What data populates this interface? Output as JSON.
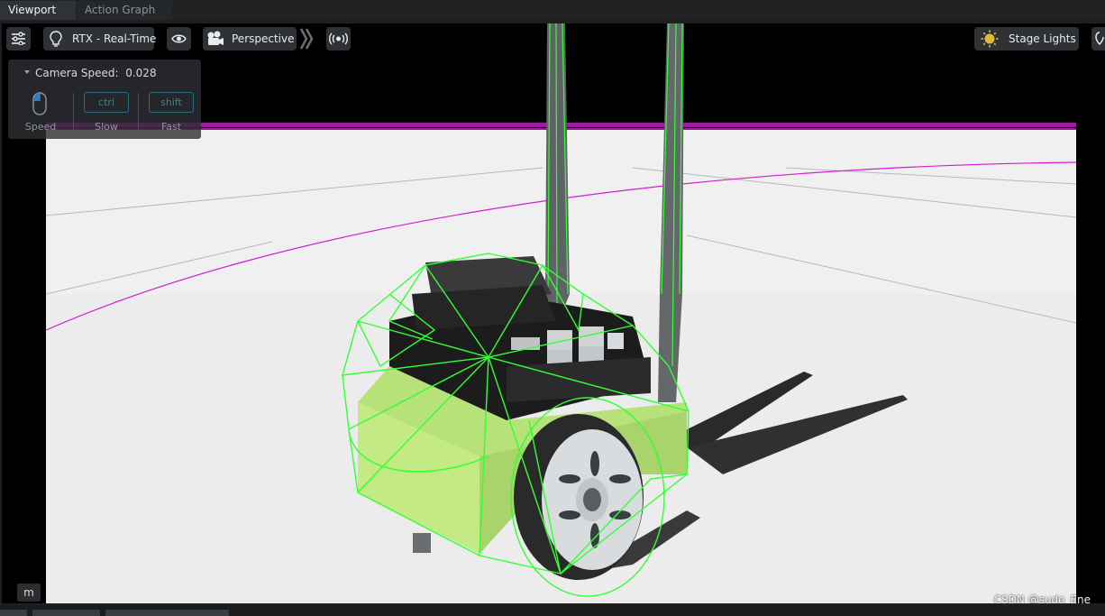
{
  "tabs": [
    {
      "label": "Viewport",
      "active": true
    },
    {
      "label": "Action Graph",
      "active": false
    }
  ],
  "toolbar": {
    "settings_icon": "sliders-icon",
    "render_mode": {
      "icon": "lightbulb-icon",
      "label": "RTX - Real-Time"
    },
    "visibility_icon": "eye-icon",
    "camera": {
      "icon": "camera-icon",
      "label": "Perspective"
    },
    "expand_icon": "double-chevron-right-icon",
    "audio_icon": "broadcast-icon",
    "lights": {
      "icon": "sun-icon",
      "label": "Stage Lights"
    }
  },
  "camera_speed": {
    "title": "Camera Speed:",
    "value": "0.028",
    "keys": [
      {
        "key": "",
        "label": "Speed",
        "icon": "mouse-icon"
      },
      {
        "key": "ctrl",
        "label": "Slow"
      },
      {
        "key": "shift",
        "label": "Fast"
      }
    ]
  },
  "m_button": "m",
  "watermark": "CSDN @sudo_Ene",
  "colors": {
    "grid_magenta": "#d21ed2",
    "wireframe_green": "#33ff33",
    "chassis_green": "#b7e27a",
    "floor": "#f1f1f1"
  }
}
